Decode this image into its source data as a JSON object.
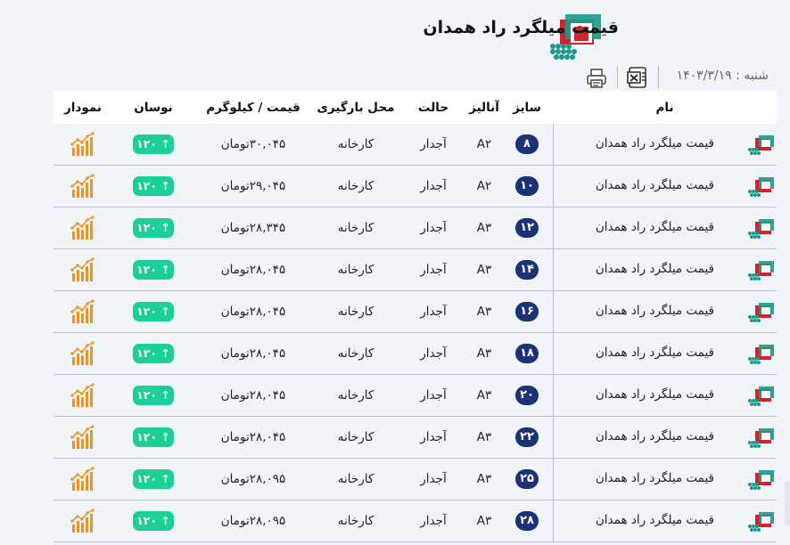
{
  "header": {
    "title": "قیمت میلگرد راد همدان",
    "date": "شنبه : ۱۴۰۳/۳/۱۹"
  },
  "columns": {
    "name": "نام",
    "size": "سایز",
    "analysis": "آنالیز",
    "state": "حالت",
    "location": "محل بارگیری",
    "price": "قیمت / کیلوگرم",
    "oscillation": "نوسان",
    "chart": "نمودار"
  },
  "rows": [
    {
      "name": "قیمت میلگرد راد همدان",
      "size": "۸",
      "analysis": "A۲",
      "state": "آجدار",
      "location": "کارخانه",
      "price": "۳۰,۰۴۵تومان",
      "oscillation": "↑ ۱۲۰"
    },
    {
      "name": "قیمت میلگرد راد همدان",
      "size": "۱۰",
      "analysis": "A۲",
      "state": "آجدار",
      "location": "کارخانه",
      "price": "۲۹,۰۴۵تومان",
      "oscillation": "↑ ۱۲۰"
    },
    {
      "name": "قیمت میلگرد راد همدان",
      "size": "۱۲",
      "analysis": "A۳",
      "state": "آجدار",
      "location": "کارخانه",
      "price": "۲۸,۳۴۵تومان",
      "oscillation": "↑ ۱۲۰"
    },
    {
      "name": "قیمت میلگرد راد همدان",
      "size": "۱۴",
      "analysis": "A۳",
      "state": "آجدار",
      "location": "کارخانه",
      "price": "۲۸,۰۴۵تومان",
      "oscillation": "↑ ۱۲۰"
    },
    {
      "name": "قیمت میلگرد راد همدان",
      "size": "۱۶",
      "analysis": "A۳",
      "state": "آجدار",
      "location": "کارخانه",
      "price": "۲۸,۰۴۵تومان",
      "oscillation": "↑ ۱۲۰"
    },
    {
      "name": "قیمت میلگرد راد همدان",
      "size": "۱۸",
      "analysis": "A۳",
      "state": "آجدار",
      "location": "کارخانه",
      "price": "۲۸,۰۴۵تومان",
      "oscillation": "↑ ۱۲۰"
    },
    {
      "name": "قیمت میلگرد راد همدان",
      "size": "۲۰",
      "analysis": "A۳",
      "state": "آجدار",
      "location": "کارخانه",
      "price": "۲۸,۰۴۵تومان",
      "oscillation": "↑ ۱۲۰"
    },
    {
      "name": "قیمت میلگرد راد همدان",
      "size": "۲۲",
      "analysis": "A۳",
      "state": "آجدار",
      "location": "کارخانه",
      "price": "۲۸,۰۴۵تومان",
      "oscillation": "↑ ۱۲۰"
    },
    {
      "name": "قیمت میلگرد راد همدان",
      "size": "۲۵",
      "analysis": "A۳",
      "state": "آجدار",
      "location": "کارخانه",
      "price": "۲۸,۰۹۵تومان",
      "oscillation": "↑ ۱۲۰"
    },
    {
      "name": "قیمت میلگرد راد همدان",
      "size": "۲۸",
      "analysis": "A۳",
      "state": "آجدار",
      "location": "کارخانه",
      "price": "۲۸,۰۹۵تومان",
      "oscillation": "↑ ۱۲۰"
    }
  ],
  "icons": {
    "logo": "rebar-bundle-logo",
    "excel": "excel-export-icon",
    "print": "printer-icon",
    "row_icon": "rebar-bundle-icon",
    "chart": "bar-chart-icon"
  },
  "colors": {
    "size_badge": "#1b3276",
    "oscillation_badge": "#1ccf94",
    "chart_icon": "#f2911d",
    "brand_red": "#d6202a",
    "brand_teal": "#1a9a8c"
  }
}
